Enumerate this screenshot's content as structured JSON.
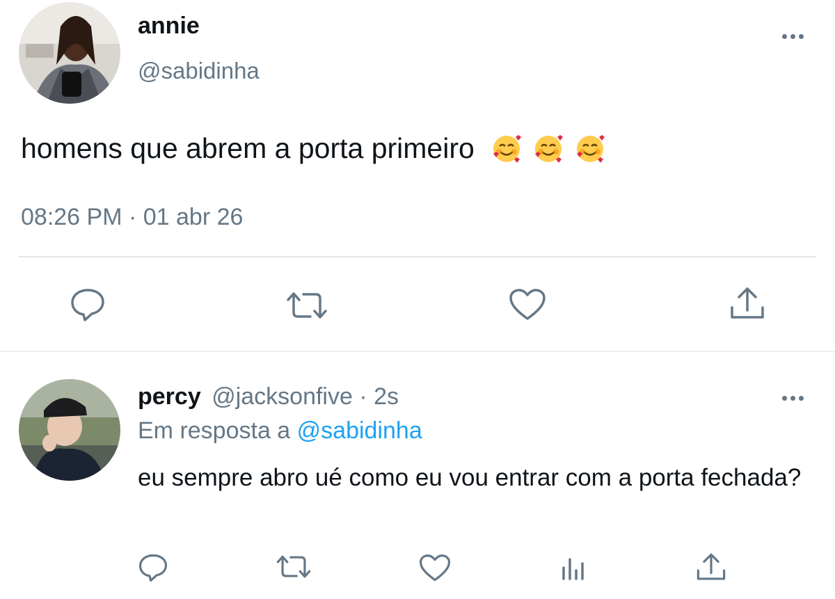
{
  "main_tweet": {
    "display_name": "annie",
    "handle": "@sabidinha",
    "text": "homens que abrem a porta primeiro",
    "emojis": [
      "smiling-face-with-hearts",
      "smiling-face-with-hearts",
      "smiling-face-with-hearts"
    ],
    "timestamp": "08:26 PM · 01 abr 26",
    "actions": [
      "reply-icon",
      "retweet-icon",
      "like-icon",
      "share-icon"
    ]
  },
  "reply_tweet": {
    "display_name": "percy",
    "handle": "@jacksonfive",
    "separator": "·",
    "time_ago": "2s",
    "replying_prefix": "Em resposta a",
    "replying_to": "@sabidinha",
    "text": "eu sempre abro ué como eu vou entrar com a porta fechada?",
    "actions": [
      "reply-icon",
      "retweet-icon",
      "like-icon",
      "analytics-icon",
      "share-icon"
    ]
  },
  "colors": {
    "link": "#1da1f2",
    "muted": "#657786",
    "divider": "#e1e6ea"
  }
}
